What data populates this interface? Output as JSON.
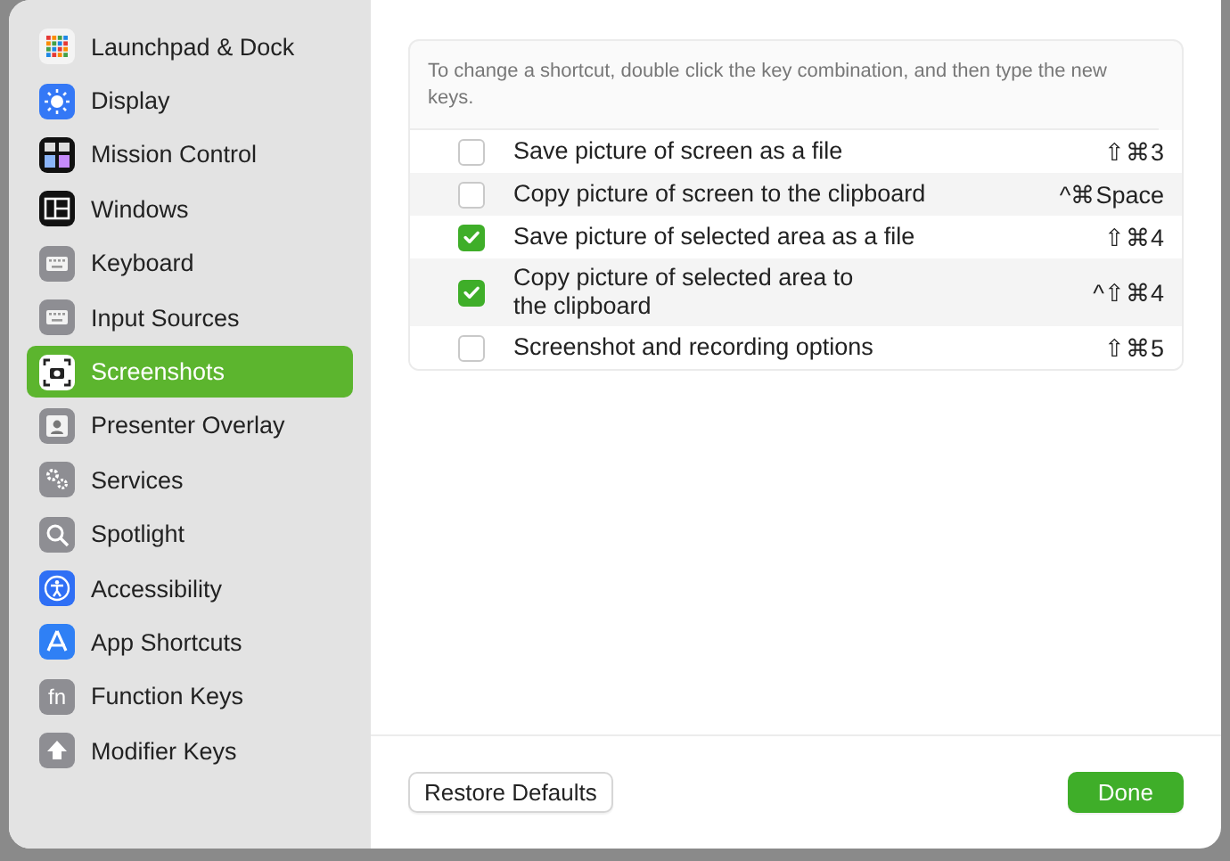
{
  "sidebar": {
    "items": [
      {
        "label": "Launchpad & Dock",
        "selected": false
      },
      {
        "label": "Display",
        "selected": false
      },
      {
        "label": "Mission Control",
        "selected": false
      },
      {
        "label": "Windows",
        "selected": false
      },
      {
        "label": "Keyboard",
        "selected": false
      },
      {
        "label": "Input Sources",
        "selected": false
      },
      {
        "label": "Screenshots",
        "selected": true
      },
      {
        "label": "Presenter Overlay",
        "selected": false
      },
      {
        "label": "Services",
        "selected": false
      },
      {
        "label": "Spotlight",
        "selected": false
      },
      {
        "label": "Accessibility",
        "selected": false
      },
      {
        "label": "App Shortcuts",
        "selected": false
      },
      {
        "label": "Function Keys",
        "selected": false,
        "icon_label": "fn"
      },
      {
        "label": "Modifier Keys",
        "selected": false
      }
    ]
  },
  "hint": "To change a shortcut, double click the key combination, and then type the new keys.",
  "shortcuts": [
    {
      "label": "Save picture of screen as a file",
      "checked": false,
      "keys": "⇧⌘3"
    },
    {
      "label": "Copy picture of screen to the clipboard",
      "checked": false,
      "keys": "^⌘Space"
    },
    {
      "label": "Save picture of selected area as a file",
      "checked": true,
      "keys": "⇧⌘4"
    },
    {
      "label": "Copy picture of selected area to\nthe clipboard",
      "checked": true,
      "keys": "^⇧⌘4"
    },
    {
      "label": "Screenshot and recording options",
      "checked": false,
      "keys": "⇧⌘5"
    }
  ],
  "buttons": {
    "restore": "Restore Defaults",
    "done": "Done"
  }
}
